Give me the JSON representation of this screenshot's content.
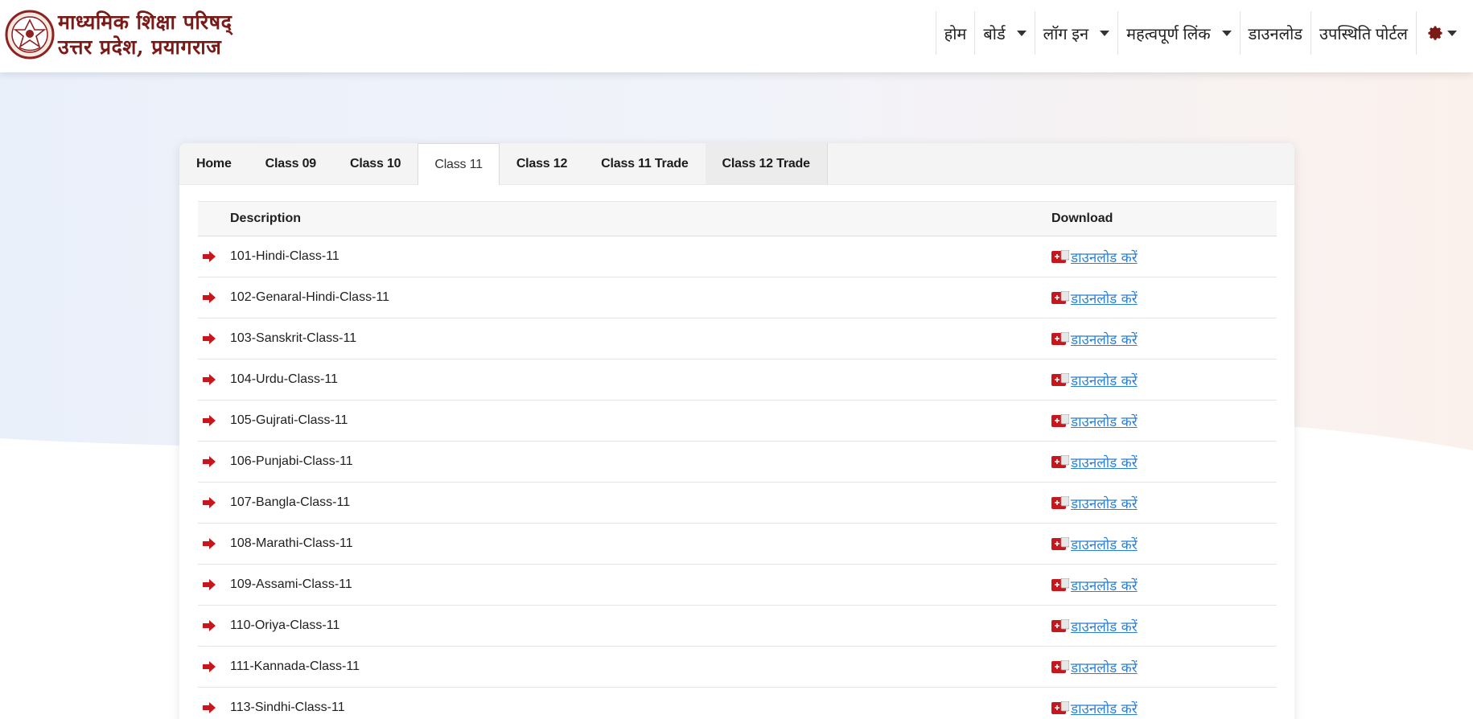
{
  "header": {
    "title_line1": "माध्यमिक शिक्षा परिषद्",
    "title_line2": "उत्तर प्रदेश, प्रयागराज",
    "logo_icon": "up-board-emblem-icon",
    "nav": [
      {
        "label": "होम",
        "dropdown": false
      },
      {
        "label": "बोर्ड",
        "dropdown": true
      },
      {
        "label": "लॉग इन",
        "dropdown": true
      },
      {
        "label": "महत्वपूर्ण लिंक",
        "dropdown": true
      },
      {
        "label": "डाउनलोड",
        "dropdown": false
      },
      {
        "label": "उपस्थिति पोर्टल",
        "dropdown": false
      }
    ],
    "settings_icon": "gear-icon"
  },
  "tabs": [
    {
      "label": "Home",
      "active": false
    },
    {
      "label": "Class 09",
      "active": false
    },
    {
      "label": "Class 10",
      "active": false
    },
    {
      "label": "Class 11",
      "active": true
    },
    {
      "label": "Class 12",
      "active": false
    },
    {
      "label": "Class 11 Trade",
      "active": false
    },
    {
      "label": "Class 12 Trade",
      "active": false
    }
  ],
  "table": {
    "headers": {
      "description": "Description",
      "download": "Download"
    },
    "download_label": "डाउनलोड करें",
    "row_icon": "red-arrow-right-icon",
    "download_icon": "pdf-icon",
    "rows": [
      "101-Hindi-Class-11",
      "102-Genaral-Hindi-Class-11",
      "103-Sanskrit-Class-11",
      "104-Urdu-Class-11",
      "105-Gujrati-Class-11",
      "106-Punjabi-Class-11",
      "107-Bangla-Class-11",
      "108-Marathi-Class-11",
      "109-Assami-Class-11",
      "110-Oriya-Class-11",
      "111-Kannada-Class-11",
      "113-Sindhi-Class-11"
    ]
  },
  "colors": {
    "brand_maroon": "#7a1a17",
    "link_blue": "#2a7fd4",
    "arrow_red": "#c8161d"
  }
}
